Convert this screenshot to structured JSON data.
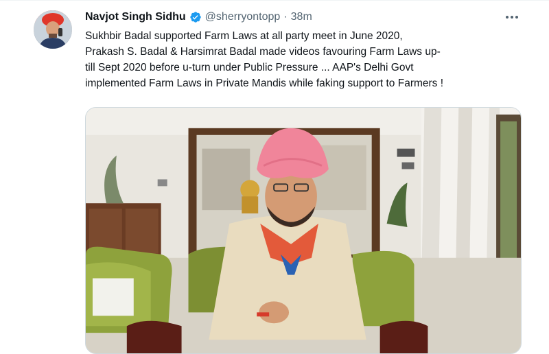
{
  "tweet": {
    "author_name": "Navjot Singh Sidhu",
    "handle": "@sherryontopp",
    "separator": "·",
    "time": "38m",
    "more_icon": "more-horizontal-icon",
    "verified_icon": "verified-badge-icon",
    "lines": [
      "Sukhbir Badal supported Farm Laws at all party meet in June 2020,",
      "Prakash S. Badal & Harsimrat Badal made videos favouring Farm Laws up-",
      "till Sept 2020 before u-turn under Public Pressure ... AAP's Delhi Govt",
      "implemented Farm Laws in Private Mandis while faking support to Farmers !"
    ]
  },
  "colors": {
    "verified": "#1d9bf0",
    "secondary_text": "#536471",
    "primary_text": "#0f1419"
  }
}
